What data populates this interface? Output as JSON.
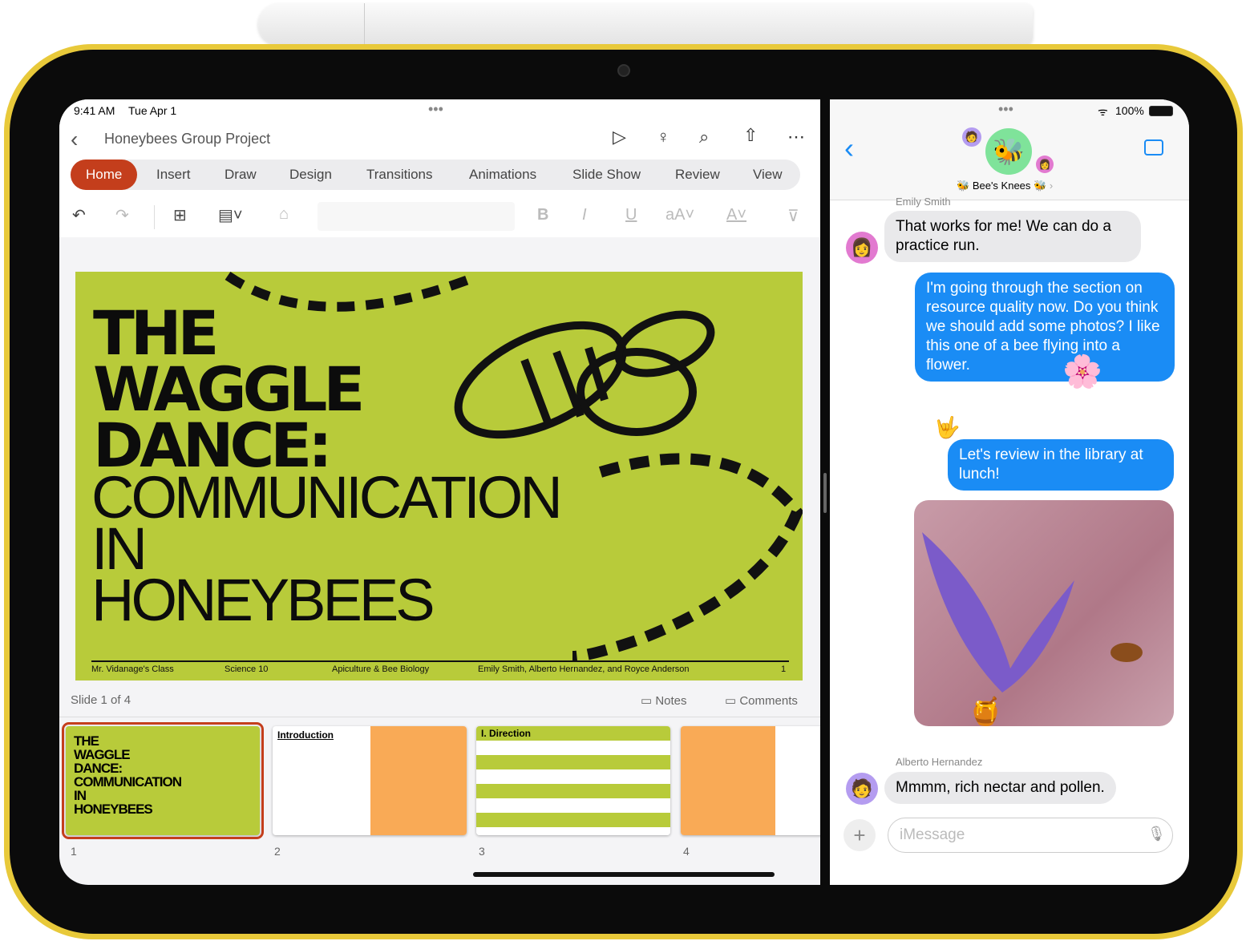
{
  "status": {
    "time": "9:41 AM",
    "date": "Tue Apr 1",
    "battery": "100%"
  },
  "ppt": {
    "title": "Honeybees Group Project",
    "tabs": [
      "Home",
      "Insert",
      "Draw",
      "Design",
      "Transitions",
      "Animations",
      "Slide Show",
      "Review",
      "View"
    ],
    "active_tab": "Home",
    "accent": "#c43e1c",
    "slide": {
      "title_bold": [
        "THE",
        "WAGGLE",
        "DANCE:"
      ],
      "title_thin": [
        "COMMUNICATION",
        "IN",
        "HONEYBEES"
      ],
      "footer": [
        "Mr. Vidanage's Class",
        "Science 10",
        "Apiculture & Bee Biology",
        "Emily Smith, Alberto Hernandez, and Royce Anderson",
        "1"
      ],
      "bg": "#b8cb3a"
    },
    "slide_counter": "Slide 1 of 4",
    "notes_label": "Notes",
    "comments_label": "Comments",
    "thumbs": [
      {
        "num": "1",
        "title": "THE WAGGLE DANCE: COMMUNICATION IN HONEYBEES"
      },
      {
        "num": "2",
        "title": "Introduction"
      },
      {
        "num": "3",
        "title": "I. Direction"
      },
      {
        "num": "4",
        "title": ""
      }
    ]
  },
  "messages": {
    "group_name": "Bee's Knees",
    "top_sender": "Emily Smith",
    "items": [
      {
        "from": "Emily Smith",
        "text": "That works for me! We can do a practice run.",
        "type": "received"
      },
      {
        "text": "I'm going through the section on resource quality now. Do you think we should add some photos? I like this one of a bee flying into a flower.",
        "type": "sent"
      },
      {
        "text": "Let's review in the library at lunch!",
        "type": "sent"
      },
      {
        "from": "Alberto Hernandez",
        "text": "Mmmm, rich nectar and pollen.",
        "type": "received"
      }
    ],
    "input_placeholder": "iMessage",
    "accent": "#1a8cf5"
  }
}
